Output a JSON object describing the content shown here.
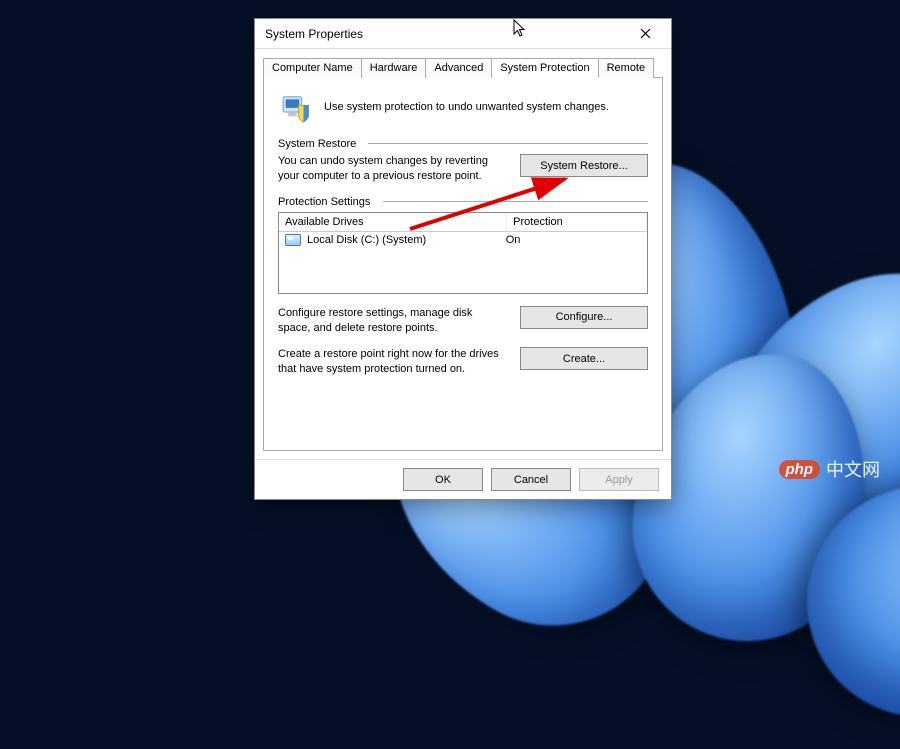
{
  "window": {
    "title": "System Properties",
    "intro_text": "Use system protection to undo unwanted system changes."
  },
  "tabs": [
    {
      "label": "Computer Name"
    },
    {
      "label": "Hardware"
    },
    {
      "label": "Advanced"
    },
    {
      "label": "System Protection"
    },
    {
      "label": "Remote"
    }
  ],
  "restore": {
    "group_label": "System Restore",
    "text": "You can undo system changes by reverting your computer to a previous restore point.",
    "button": "System Restore..."
  },
  "protection": {
    "group_label": "Protection Settings",
    "col_drives": "Available Drives",
    "col_protection": "Protection",
    "drives": [
      {
        "name": "Local Disk (C:) (System)",
        "status": "On"
      }
    ],
    "configure_text": "Configure restore settings, manage disk space, and delete restore points.",
    "configure_button": "Configure...",
    "create_text": "Create a restore point right now for the drives that have system protection turned on.",
    "create_button": "Create..."
  },
  "dialog_buttons": {
    "ok": "OK",
    "cancel": "Cancel",
    "apply": "Apply"
  },
  "watermark": {
    "badge": "php",
    "text": "中文网"
  }
}
